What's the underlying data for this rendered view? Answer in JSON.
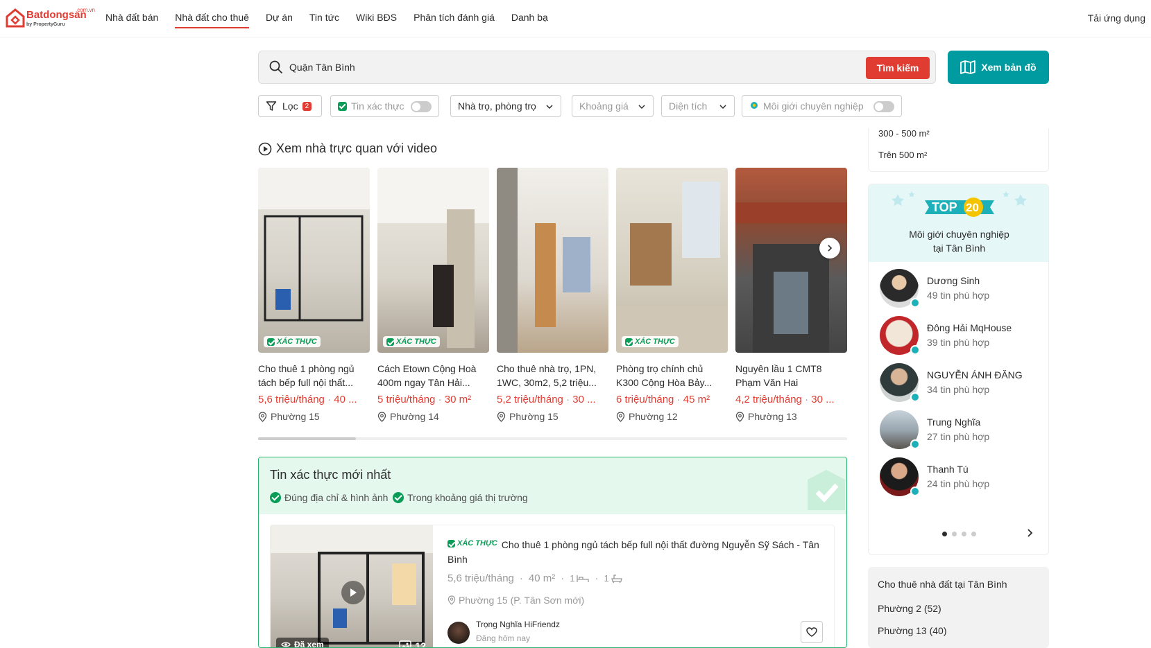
{
  "header": {
    "logo_brand": "Batdongsan",
    "logo_tld": ".com.vn",
    "logo_by": "by PropertyGuru",
    "nav": [
      "Nhà đất bán",
      "Nhà đất cho thuê",
      "Dự án",
      "Tin tức",
      "Wiki BĐS",
      "Phân tích đánh giá",
      "Danh bạ"
    ],
    "active_nav": "Nhà đất cho thuê",
    "app_link": "Tải ứng dụng",
    "brand_color": "#e03c31"
  },
  "search": {
    "value": "Quận Tân Bình",
    "button": "Tìm kiếm",
    "map_button": "Xem bản đồ"
  },
  "filters": {
    "filter_label": "Lọc",
    "filter_count": "2",
    "verified_label": "Tin xác thực",
    "type_value": "Nhà trọ, phòng trọ",
    "price_placeholder": "Khoảng giá",
    "area_placeholder": "Diện tích",
    "broker_label": "Môi giới chuyên nghiệp"
  },
  "video_section": {
    "title": "Xem nhà trực quan với video",
    "verified_badge": "XÁC THỰC",
    "cards": [
      {
        "title": "Cho thuê 1 phòng ngủ tách bếp full nội thất...",
        "price": "5,6 triệu/tháng",
        "area": "40 ...",
        "location": "Phường 15",
        "verified": true
      },
      {
        "title": "Cách Etown Cộng Hoà 400m ngay Tân Hải...",
        "price": "5 triệu/tháng",
        "area": "30 m²",
        "location": "Phường 14",
        "verified": true
      },
      {
        "title": "Cho thuê nhà trọ, 1PN, 1WC, 30m2, 5,2 triệu...",
        "price": "5,2 triệu/tháng",
        "area": "30 ...",
        "location": "Phường 15",
        "verified": false
      },
      {
        "title": "Phòng trọ chính chủ K300 Cộng Hòa Bảy...",
        "price": "6 triệu/tháng",
        "area": "45 m²",
        "location": "Phường 12",
        "verified": true
      },
      {
        "title": "Nguyên lầu 1 CMT8 Phạm Văn Hai",
        "price": "4,2 triệu/tháng",
        "area": "30 ...",
        "location": "Phường 13",
        "verified": false
      }
    ]
  },
  "verified_section": {
    "title": "Tin xác thực mới nhất",
    "features": [
      "Đúng địa chỉ & hình ảnh",
      "Trong khoảng giá thị trường"
    ],
    "listing": {
      "badge": "XÁC THỰC",
      "title": "Cho thuê 1 phòng ngủ tách bếp full nội thất đường Nguyễn Sỹ Sách - Tân Bình",
      "price": "5,6 triệu/tháng",
      "area": "40 m²",
      "bedrooms": "1",
      "bathrooms": "1",
      "location": "Phường 15 (P. Tân Sơn mới)",
      "seen_label": "Đã xem",
      "image_count": "12",
      "agent": "Trọng Nghĩa HiFriendz",
      "posted": "Đăng hôm nay"
    }
  },
  "sidebar": {
    "area_options": [
      "300 - 500 m²",
      "Trên 500 m²"
    ],
    "top20": {
      "badge_top": "TOP",
      "badge_num": "20",
      "title_line1": "Môi giới chuyên nghiệp",
      "title_line2": "tại Tân Bình",
      "agents": [
        {
          "name": "Dương Sinh",
          "count": "49 tin phù hợp"
        },
        {
          "name": "Đông Hải MqHouse",
          "count": "39 tin phù hợp"
        },
        {
          "name": "NGUYỄN ÁNH ĐĂNG",
          "count": "34 tin phù hợp"
        },
        {
          "name": "Trung Nghĩa",
          "count": "27 tin phù hợp"
        },
        {
          "name": "Thanh Tú",
          "count": "24 tin phù hợp"
        }
      ]
    },
    "rent_box": {
      "title": "Cho thuê nhà đất tại Tân Bình",
      "items": [
        "Phường 2 (52)",
        "Phường 13 (40)"
      ]
    }
  }
}
